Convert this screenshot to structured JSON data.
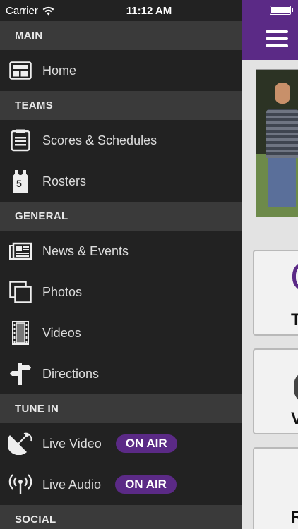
{
  "status": {
    "carrier": "Carrier",
    "time": "11:12 AM"
  },
  "sections": {
    "main": "MAIN",
    "teams": "TEAMS",
    "general": "GENERAL",
    "tune_in": "TUNE IN",
    "social": "SOCIAL"
  },
  "items": {
    "home": {
      "label": "Home",
      "icon": "layout-grid-icon"
    },
    "scores": {
      "label": "Scores & Schedules",
      "icon": "clipboard-list-icon"
    },
    "rosters": {
      "label": "Rosters",
      "icon": "jersey-icon"
    },
    "news": {
      "label": "News & Events",
      "icon": "newspaper-icon"
    },
    "photos": {
      "label": "Photos",
      "icon": "photos-icon"
    },
    "videos": {
      "label": "Videos",
      "icon": "film-strip-icon"
    },
    "directions": {
      "label": "Directions",
      "icon": "signpost-icon"
    },
    "live_video": {
      "label": "Live Video",
      "icon": "satellite-dish-icon",
      "badge": "ON AIR"
    },
    "live_audio": {
      "label": "Live Audio",
      "icon": "broadcast-antenna-icon",
      "badge": "ON AIR"
    }
  },
  "jersey_number": "5",
  "behind": {
    "card_letters": [
      "T",
      "V",
      "R"
    ]
  },
  "colors": {
    "accent": "#5b2a86",
    "drawer_bg": "#222222",
    "section_bg": "#3a3a3a"
  }
}
